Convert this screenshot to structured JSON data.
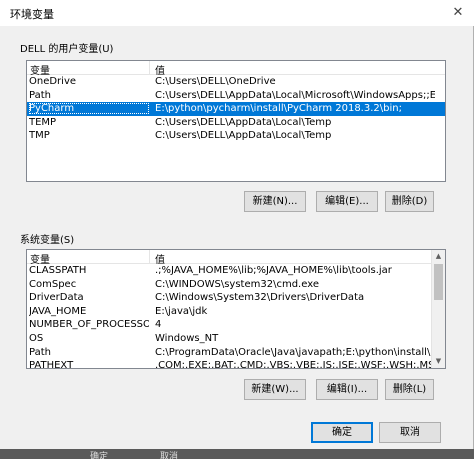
{
  "window": {
    "title": "环境变量",
    "close_glyph": "✕"
  },
  "user_vars": {
    "group_label": "DELL 的用户变量(U)",
    "col_name": "变量",
    "col_value": "值",
    "rows": [
      {
        "name": "OneDrive",
        "value": "C:\\Users\\DELL\\OneDrive"
      },
      {
        "name": "Path",
        "value": "C:\\Users\\DELL\\AppData\\Local\\Microsoft\\WindowsApps;;E:\\pytho..."
      },
      {
        "name": "PyCharm",
        "value": "E:\\python\\pycharm\\install\\PyCharm 2018.3.2\\bin;"
      },
      {
        "name": "TEMP",
        "value": "C:\\Users\\DELL\\AppData\\Local\\Temp"
      },
      {
        "name": "TMP",
        "value": "C:\\Users\\DELL\\AppData\\Local\\Temp"
      }
    ],
    "selected_index": 2,
    "buttons": {
      "new": "新建(N)...",
      "edit": "编辑(E)...",
      "delete": "删除(D)"
    }
  },
  "system_vars": {
    "group_label": "系统变量(S)",
    "col_name": "变量",
    "col_value": "值",
    "rows": [
      {
        "name": "CLASSPATH",
        "value": ".;%JAVA_HOME%\\lib;%JAVA_HOME%\\lib\\tools.jar"
      },
      {
        "name": "ComSpec",
        "value": "C:\\WINDOWS\\system32\\cmd.exe"
      },
      {
        "name": "DriverData",
        "value": "C:\\Windows\\System32\\Drivers\\DriverData"
      },
      {
        "name": "JAVA_HOME",
        "value": "E:\\java\\jdk"
      },
      {
        "name": "NUMBER_OF_PROCESSORS",
        "value": "4"
      },
      {
        "name": "OS",
        "value": "Windows_NT"
      },
      {
        "name": "Path",
        "value": "C:\\ProgramData\\Oracle\\Java\\javapath;E:\\python\\install\\E:\\pytho..."
      },
      {
        "name": "PATHEXT",
        "value": ".COM;.EXE;.BAT;.CMD;.VBS;.VBE;.JS;.JSE;.WSF;.WSH;.MSC"
      }
    ],
    "buttons": {
      "new": "新建(W)...",
      "edit": "编辑(I)...",
      "delete": "删除(L)"
    }
  },
  "footer": {
    "ok": "确定",
    "cancel": "取消"
  },
  "background": {
    "left": "确定",
    "mid": "取消"
  }
}
